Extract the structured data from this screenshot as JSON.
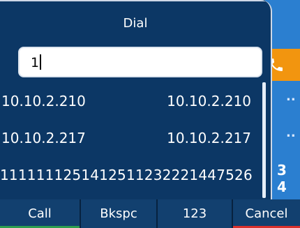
{
  "dialog": {
    "title": "Dial",
    "input_value": "1"
  },
  "suggestions": [
    {
      "left": "10.10.2.210",
      "right": "10.10.2.210"
    },
    {
      "left": "10.10.2.217",
      "right": "10.10.2.217"
    },
    {
      "full": "1111111251412511232221447526"
    }
  ],
  "background": {
    "dots_1": "..",
    "dots_2": "..",
    "partial_number": "3 4"
  },
  "softkeys": [
    {
      "label": "Call",
      "accent": "#2e9e4f"
    },
    {
      "label": "Bkspc",
      "accent": ""
    },
    {
      "label": "123",
      "accent": ""
    },
    {
      "label": "Cancel",
      "accent": "#d9312c"
    }
  ],
  "colors": {
    "background_panel": "#2b7fd0",
    "call_icon_bg": "#f2950f",
    "dialog_bg": "#0c3765"
  },
  "icons": {
    "call": "phone-handset-icon"
  }
}
